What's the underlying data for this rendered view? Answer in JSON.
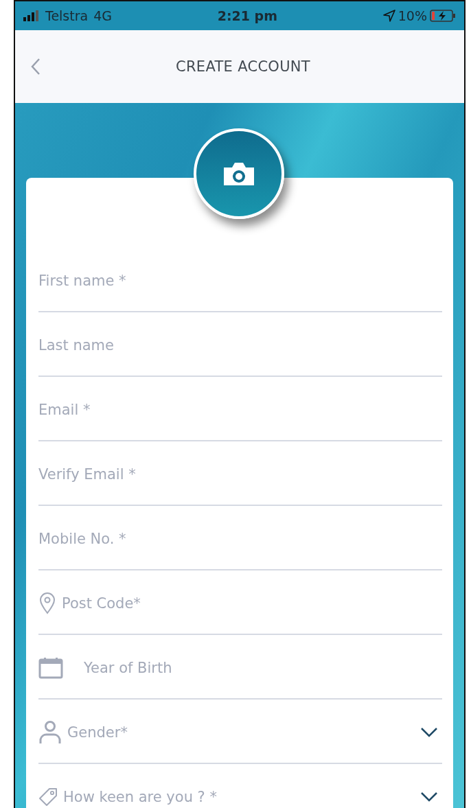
{
  "status_bar": {
    "carrier": "Telstra",
    "network": "4G",
    "time": "2:21 pm",
    "battery": "10%"
  },
  "header": {
    "title": "CREATE ACCOUNT"
  },
  "fields": [
    {
      "placeholder": "First name *",
      "kind": "plain",
      "dropdown": false
    },
    {
      "placeholder": "Last name",
      "kind": "plain",
      "dropdown": false
    },
    {
      "placeholder": "Email *",
      "kind": "plain",
      "dropdown": false
    },
    {
      "placeholder": "Verify Email *",
      "kind": "plain",
      "dropdown": false
    },
    {
      "placeholder": "Mobile No. *",
      "kind": "plain",
      "dropdown": false
    },
    {
      "placeholder": "Post Code*",
      "kind": "location",
      "dropdown": false
    },
    {
      "placeholder": "Year of Birth",
      "kind": "date",
      "dropdown": false
    },
    {
      "placeholder": "Gender*",
      "kind": "person",
      "dropdown": true
    },
    {
      "placeholder": "How keen are you ? *",
      "kind": "rating",
      "dropdown": true
    }
  ]
}
